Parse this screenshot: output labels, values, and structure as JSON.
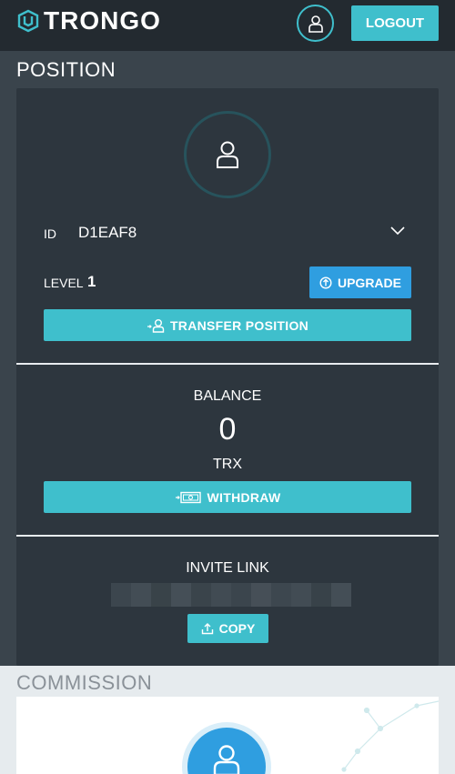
{
  "header": {
    "brand": "TRONGO",
    "logout_label": "LOGOUT"
  },
  "position_section": {
    "title": "POSITION",
    "id_label": "ID",
    "id_value": "D1EAF8",
    "level_label": "LEVEL",
    "level_value": "1",
    "upgrade_label": "UPGRADE",
    "transfer_label": "TRANSFER POSITION"
  },
  "balance_section": {
    "label": "BALANCE",
    "value": "0",
    "currency": "TRX",
    "withdraw_label": "WITHDRAW"
  },
  "invite_section": {
    "label": "INVITE LINK",
    "copy_label": "COPY"
  },
  "commission_section": {
    "title": "COMMISSION"
  },
  "colors": {
    "accent": "#3fbfcc",
    "upgrade": "#2f9ee0",
    "card": "#2d363e",
    "header": "#232a30"
  },
  "icons": [
    "logo-mark-icon",
    "user-icon",
    "chevron-down-icon",
    "upgrade-icon",
    "transfer-user-icon",
    "cash-icon",
    "upload-icon"
  ]
}
